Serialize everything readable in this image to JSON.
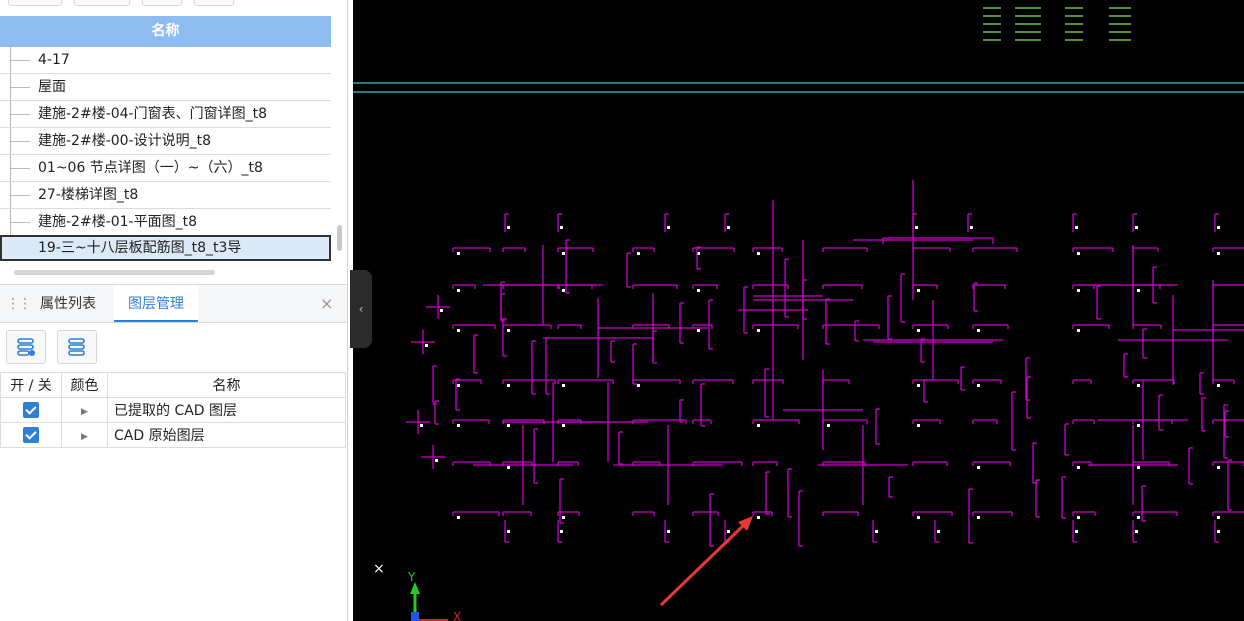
{
  "drawing_list": {
    "header": "名称",
    "items": [
      {
        "label": "4-17",
        "selected": false
      },
      {
        "label": "屋面",
        "selected": false
      },
      {
        "label": "建施-2#楼-04-门窗表、门窗详图_t8",
        "selected": false
      },
      {
        "label": "建施-2#楼-00-设计说明_t8",
        "selected": false
      },
      {
        "label": "01~06 节点详图（一）~（六）_t8",
        "selected": false
      },
      {
        "label": "27-楼梯详图_t8",
        "selected": false
      },
      {
        "label": "建施-2#楼-01-平面图_t8",
        "selected": false
      },
      {
        "label": "19-三~十八层板配筋图_t8_t3导",
        "selected": true
      }
    ]
  },
  "panel_tabs": [
    {
      "label": "属性列表",
      "active": false
    },
    {
      "label": "图层管理",
      "active": true
    }
  ],
  "close_glyph": "×",
  "layer_table": {
    "headers": [
      "开 / 关",
      "颜色",
      "名称"
    ],
    "rows": [
      {
        "checked": true,
        "name": "已提取的 CAD 图层"
      },
      {
        "checked": true,
        "name": "CAD 原始图层"
      }
    ]
  },
  "cad_view": {
    "background": "#000000",
    "rebar_color": "#cc00cc",
    "axis_line_color": "#2aa7a7",
    "text_marks_color": "#6abf4b",
    "arrow_color": "#e53935",
    "ucs_y_label": "Y",
    "ucs_x_label": "X",
    "cursor_glyph": "×"
  },
  "colors": {
    "accent": "#2f7fd6",
    "header_bg": "#8fbcf0",
    "selected_bg": "#dce9f7"
  }
}
